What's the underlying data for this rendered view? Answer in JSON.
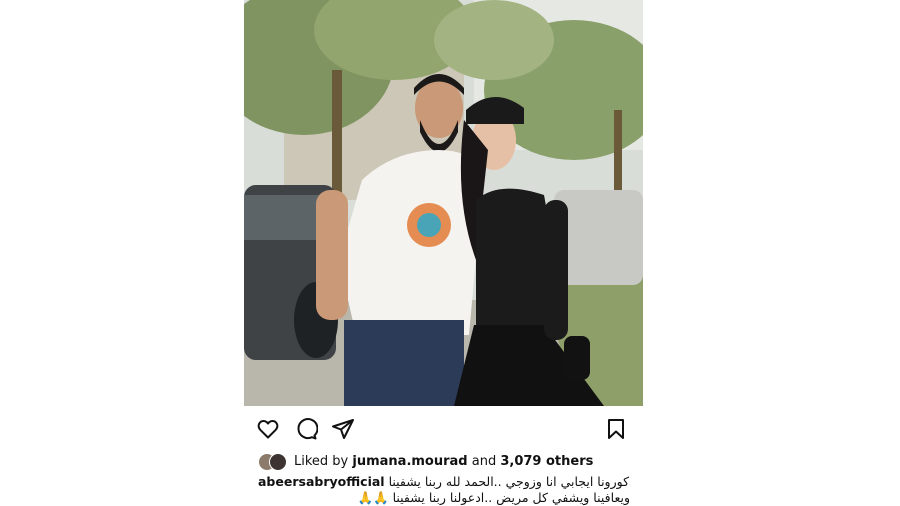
{
  "post": {
    "image_alt": "",
    "actions": {
      "like_icon": "heart-icon",
      "comment_icon": "comment-icon",
      "share_icon": "paper-plane-icon",
      "save_icon": "bookmark-icon"
    },
    "likes": {
      "prefix": "Liked by",
      "user": "jumana.mourad",
      "conjunction": "and",
      "others": "3,079 others"
    },
    "caption": {
      "username": "abeersabryofficial",
      "line1": "كورونا ايجابي انا وزوجي ..الحمد لله ربنا يشفينا",
      "line2": "ويعافينا ويشفي كل مريض ..ادعولنا ربنا يشفينا",
      "emoji": "🙏🙏"
    }
  }
}
